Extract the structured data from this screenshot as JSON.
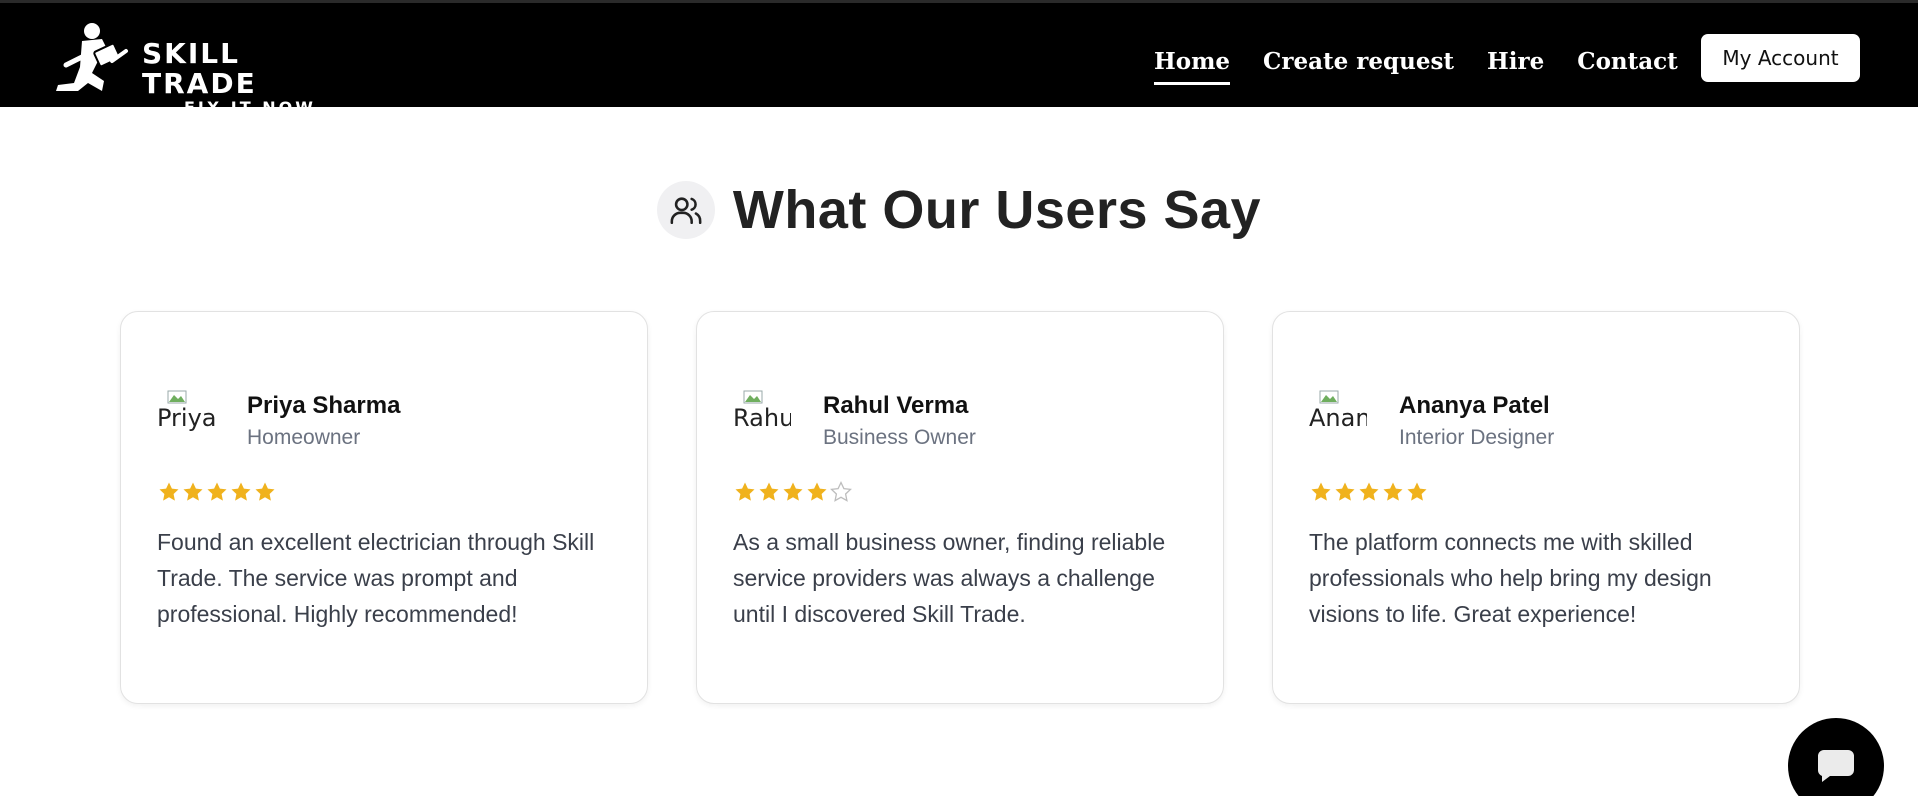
{
  "brand": {
    "title": "SKILL TRADE",
    "tagline": "FIX IT NOW"
  },
  "nav": {
    "links": [
      {
        "label": "Home",
        "active": true
      },
      {
        "label": "Create request",
        "active": false
      },
      {
        "label": "Hire",
        "active": false
      },
      {
        "label": "Contact",
        "active": false
      }
    ],
    "account_label": "My Account"
  },
  "testimonials": {
    "title": "What Our Users Say",
    "title_icon": "users-icon",
    "items": [
      {
        "avatar_alt": "Priya",
        "name": "Priya Sharma",
        "role": "Homeowner",
        "rating": 5,
        "quote": "Found an excellent electrician through Skill Trade. The service was prompt and professional. Highly recommended!"
      },
      {
        "avatar_alt": "Rahul",
        "name": "Rahul Verma",
        "role": "Business Owner",
        "rating": 4,
        "quote": "As a small business owner, finding reliable service providers was always a challenge until I discovered Skill Trade."
      },
      {
        "avatar_alt": "Ananya",
        "name": "Ananya Patel",
        "role": "Interior Designer",
        "rating": 5,
        "quote": "The platform connects me with skilled professionals who help bring my design visions to life. Great experience!"
      }
    ]
  },
  "colors": {
    "navbar_bg": "#000000",
    "star_filled": "#F0B21D",
    "star_empty": "#BDBDBD"
  },
  "chat": {
    "icon": "chat-bubble-icon"
  }
}
